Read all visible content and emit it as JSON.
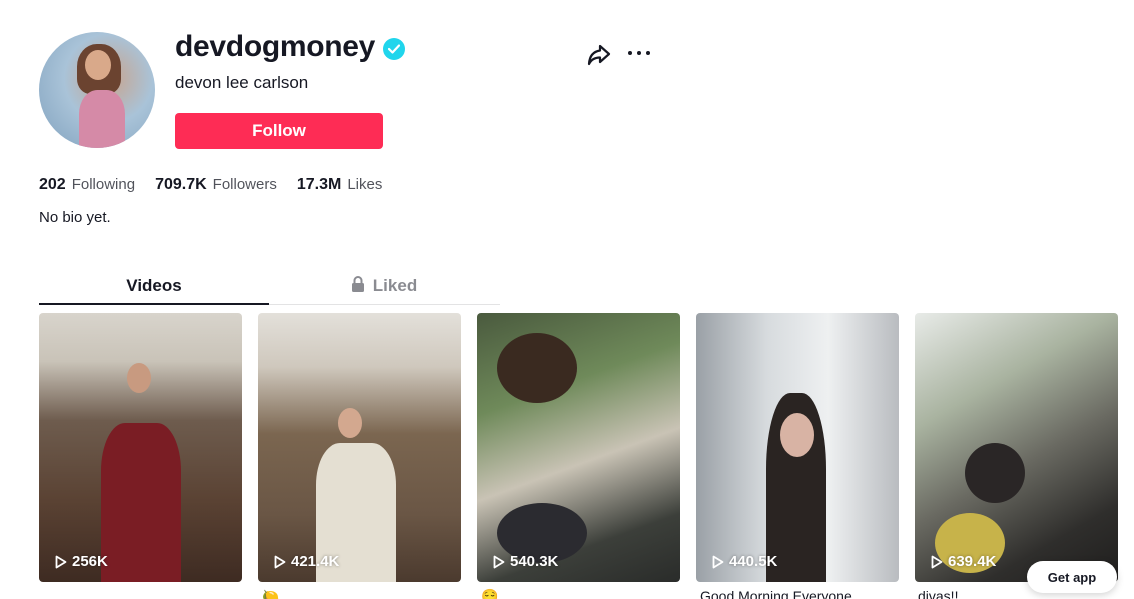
{
  "profile": {
    "username": "devdogmoney",
    "nickname": "devon lee carlson",
    "follow_label": "Follow",
    "bio": "No bio yet."
  },
  "stats": [
    {
      "num": "202",
      "label": "Following"
    },
    {
      "num": "709.7K",
      "label": "Followers"
    },
    {
      "num": "17.3M",
      "label": "Likes"
    }
  ],
  "tabs": [
    {
      "label": "Videos",
      "active": true
    },
    {
      "label": "Liked",
      "active": false,
      "icon": "lock-icon"
    }
  ],
  "videos": [
    {
      "views": "256K",
      "caption": ""
    },
    {
      "views": "421.4K",
      "caption": "🍋"
    },
    {
      "views": "540.3K",
      "caption": "😌"
    },
    {
      "views": "440.5K",
      "caption": "Good Morning Everyone"
    },
    {
      "views": "639.4K",
      "caption": "divas!!"
    }
  ],
  "get_app_label": "Get app",
  "colors": {
    "primary": "#fe2c55",
    "verified": "#20d5ec",
    "text": "#161823"
  },
  "icons": [
    "verified-badge-icon",
    "share-icon",
    "more-icon",
    "lock-icon",
    "play-icon"
  ]
}
